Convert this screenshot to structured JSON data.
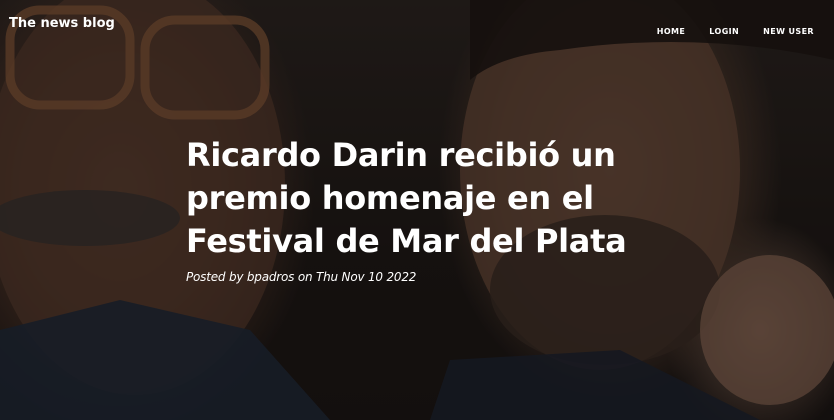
{
  "navbar": {
    "brand": "The news blog",
    "links": [
      {
        "label": "HOME"
      },
      {
        "label": "LOGIN"
      },
      {
        "label": "NEW USER"
      }
    ]
  },
  "post": {
    "title_lines": [
      "Ricardo Darin recibió un",
      "premio homenaje en el",
      "Festival de Mar del Plata"
    ],
    "meta": "Posted by bpadros on Thu Nov 10 2022"
  },
  "colors": {
    "text": "#ffffff",
    "overlay": "#0a0808"
  }
}
